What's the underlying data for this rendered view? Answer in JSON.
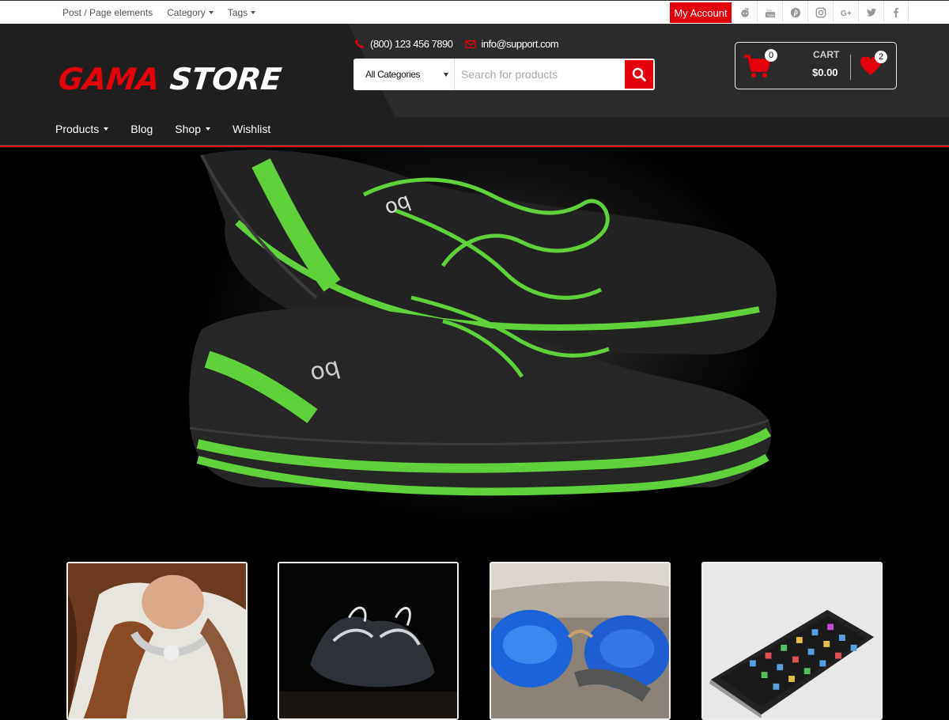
{
  "topbar": {
    "links": [
      {
        "label": "Post / Page elements",
        "has_caret": false
      },
      {
        "label": "Category",
        "has_caret": true
      },
      {
        "label": "Tags",
        "has_caret": true
      }
    ],
    "account_label": "My Account",
    "socials": [
      "reddit-icon",
      "youtube-icon",
      "pinterest-icon",
      "instagram-icon",
      "google-plus-icon",
      "twitter-icon",
      "facebook-icon"
    ]
  },
  "header": {
    "logo_part1": "GAMA",
    "logo_part2": "STORE",
    "phone": "(800) 123 456 7890",
    "email": "info@support.com",
    "search": {
      "category": "All Categories",
      "placeholder": "Search for products"
    },
    "cart": {
      "label": "CART",
      "total": "$0.00",
      "count": "0",
      "wishlist_count": "2"
    }
  },
  "nav": [
    {
      "label": "Products",
      "has_caret": true
    },
    {
      "label": "Blog",
      "has_caret": false
    },
    {
      "label": "Shop",
      "has_caret": true
    },
    {
      "label": "Wishlist",
      "has_caret": false
    }
  ],
  "colors": {
    "accent": "#e3000b",
    "header_bg": "#1f1f1f",
    "shoe_green": "#5fd13b"
  },
  "hero": {
    "image": "sneakers-photo"
  },
  "tiles": [
    {
      "image": "necklace-photo"
    },
    {
      "image": "boots-photo"
    },
    {
      "image": "sunglasses-photo"
    },
    {
      "image": "tablet-photo"
    }
  ]
}
